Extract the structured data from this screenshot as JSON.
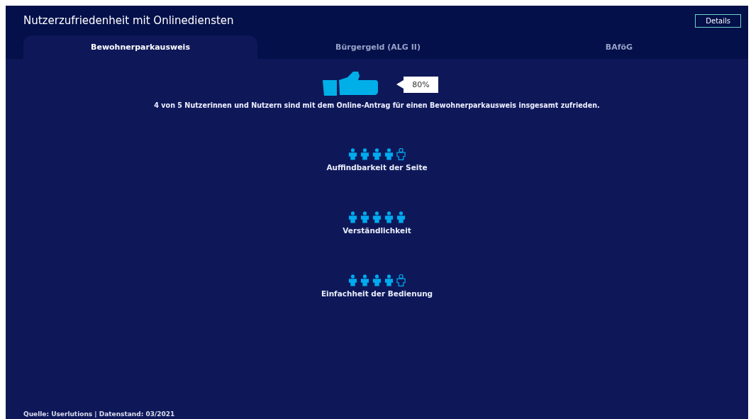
{
  "title": "Nutzerzufriedenheit mit Onlinediensten",
  "details_button": "Details",
  "tabs": [
    {
      "label": "Bewohnerparkausweis",
      "selected": true
    },
    {
      "label": "Bürgergeld (ALG II)",
      "selected": false
    },
    {
      "label": "BAföG",
      "selected": false
    }
  ],
  "overall": {
    "percent": "80%",
    "summary": "4 von 5 Nutzerinnen und Nutzern sind mit dem Online-Antrag für einen Bewohnerparkausweis insgesamt zufrieden."
  },
  "ratings": [
    {
      "label": "Auffindbarkeit der Seite",
      "stars": 4
    },
    {
      "label": "Verständlichkeit",
      "stars": 5
    },
    {
      "label": "Einfachheit der Bedienung",
      "stars": 4
    }
  ],
  "source": "Quelle: Userlutions | Datenstand: 03/2021"
}
